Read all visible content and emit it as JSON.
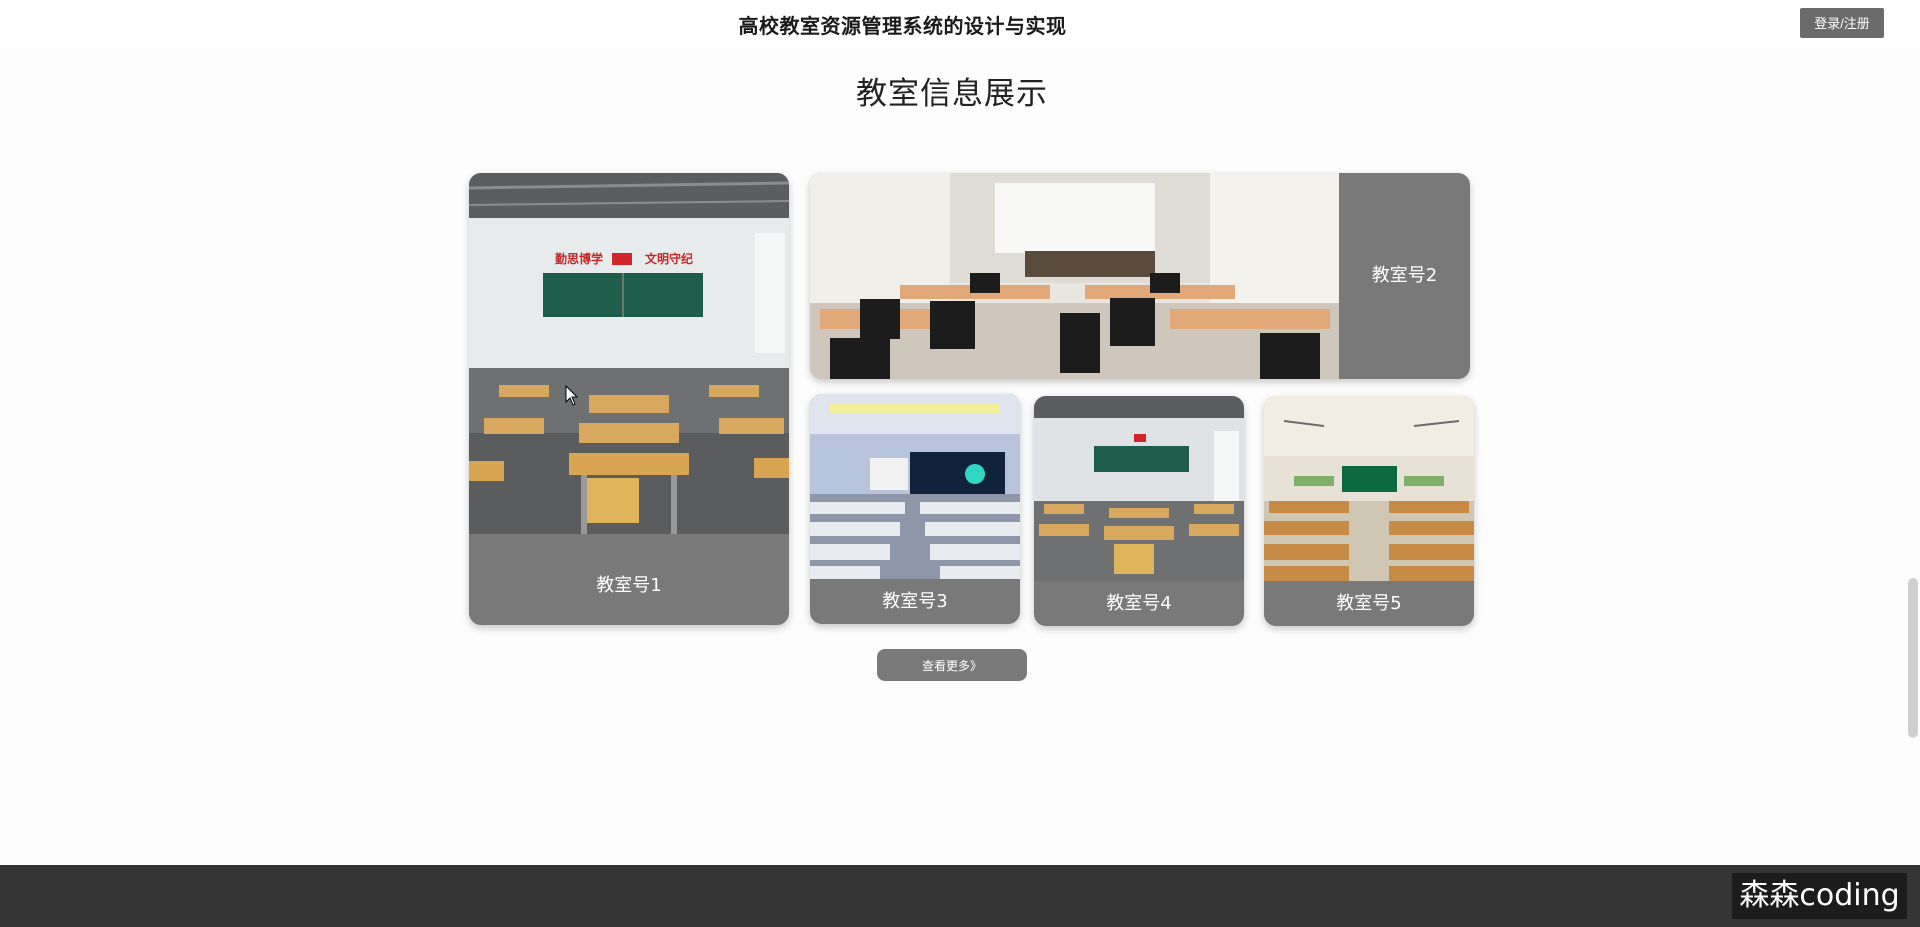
{
  "header": {
    "site_title": "高校教室资源管理系统的设计与实现",
    "login_label": "登录/注册"
  },
  "main": {
    "section_heading": "教室信息展示",
    "classrooms": [
      {
        "label": "教室号1"
      },
      {
        "label": "教室号2"
      },
      {
        "label": "教室号3"
      },
      {
        "label": "教室号4"
      },
      {
        "label": "教室号5"
      }
    ],
    "more_label": "查看更多》"
  },
  "photo_text": {
    "slogan_left": "勤思博学",
    "slogan_right": "文明守纪"
  },
  "watermark": "森森coding",
  "colors": {
    "card_bg": "#7a797a",
    "footer_bg": "#353535",
    "login_bg": "#6b6b6b"
  }
}
